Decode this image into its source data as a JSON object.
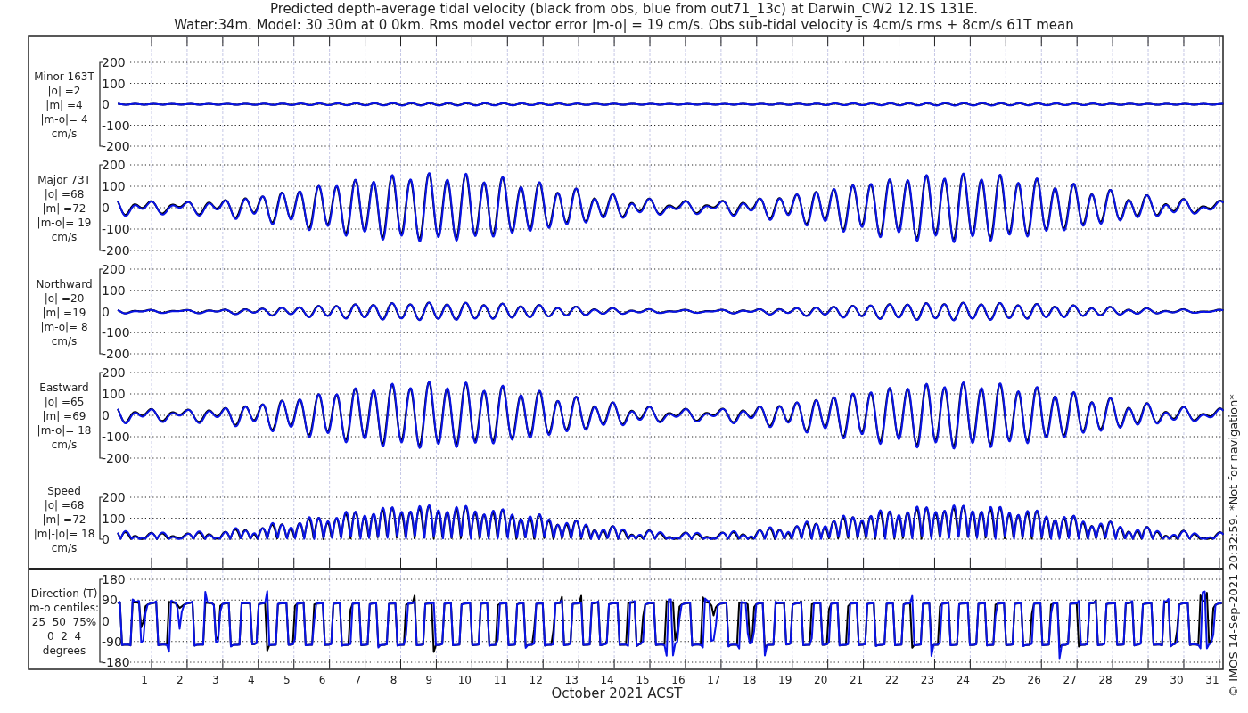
{
  "title_lines": [
    "Predicted depth-average tidal velocity (black from obs, blue from out71_13c) at Darwin_CW2 12.1S 131E.",
    "Water:34m. Model: 30 30m at 0 0km. Rms model vector error |m-o| = 19 cm/s. Obs sub-tidal velocity is 4cm/s rms + 8cm/s 61T mean"
  ],
  "panels": [
    {
      "kind": "velocity",
      "labels": [
        "Minor 163T",
        "|o| =2",
        "|m| =4",
        "|m-o|= 4",
        "cm/s"
      ],
      "yticks": [
        "200",
        "100",
        "0",
        "-100",
        "-200"
      ]
    },
    {
      "kind": "velocity",
      "labels": [
        "Major 73T",
        "|o| =68",
        "|m| =72",
        "|m-o|= 19",
        "cm/s"
      ],
      "yticks": [
        "200",
        "100",
        "0",
        "-100",
        "-200"
      ]
    },
    {
      "kind": "velocity",
      "labels": [
        "Northward",
        "|o| =20",
        "|m| =19",
        "|m-o|= 8",
        "cm/s"
      ],
      "yticks": [
        "200",
        "100",
        "0",
        "-100",
        "-200"
      ]
    },
    {
      "kind": "velocity",
      "labels": [
        "Eastward",
        "|o| =65",
        "|m| =69",
        "|m-o|= 18",
        "cm/s"
      ],
      "yticks": [
        "200",
        "100",
        "0",
        "-100",
        "-200"
      ]
    },
    {
      "kind": "speed",
      "labels": [
        "Speed",
        "|o| =68",
        "|m| =72",
        "|m|-|o|= 18",
        "cm/s"
      ],
      "yticks": [
        "200",
        "100",
        "0"
      ]
    },
    {
      "kind": "direction",
      "labels": [
        "Direction (T)",
        "m-o centiles:",
        "25  50  75%",
        "0  2  4",
        "degrees"
      ],
      "yticks": [
        "180",
        "90",
        "0",
        "-90",
        "-180"
      ]
    }
  ],
  "xticks": [
    "1",
    "2",
    "3",
    "4",
    "5",
    "6",
    "7",
    "8",
    "9",
    "10",
    "11",
    "12",
    "13",
    "14",
    "15",
    "16",
    "17",
    "18",
    "19",
    "20",
    "21",
    "22",
    "23",
    "24",
    "25",
    "26",
    "27",
    "28",
    "29",
    "30",
    "31"
  ],
  "xlabel": "October 2021 ACST",
  "credit": "© IMOS 14-Sep-2021 20:32:59. *Not for navigation*"
}
